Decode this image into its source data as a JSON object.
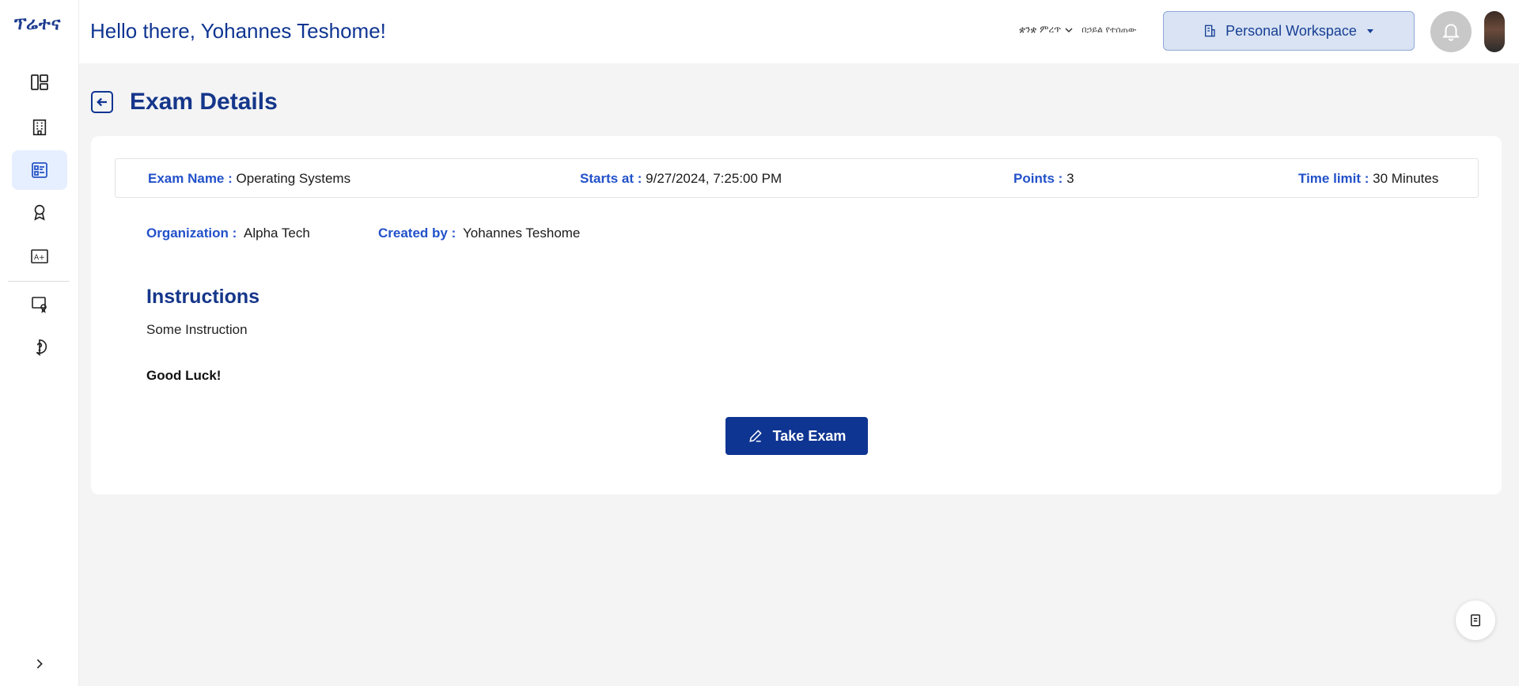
{
  "app": {
    "logo_text": "ፕሬተና",
    "greeting": "Hello there, Yohannes Teshome!",
    "language_label": "ቋንቋ ምረጥ",
    "language_sub": "በኃይል የተሰጠው",
    "workspace_label": "Personal Workspace"
  },
  "sidebar": {
    "items": [
      {
        "icon": "dashboard-icon"
      },
      {
        "icon": "building-icon"
      },
      {
        "icon": "exam-list-icon",
        "active": true
      },
      {
        "icon": "award-icon"
      },
      {
        "icon": "grades-icon"
      },
      {
        "icon": "certificate-icon"
      },
      {
        "icon": "help-icon"
      }
    ],
    "expand_icon": "chevron-right-icon"
  },
  "page": {
    "title": "Exam Details"
  },
  "exam": {
    "name_label": "Exam Name :",
    "name": "Operating Systems",
    "starts_label": "Starts at :",
    "starts": "9/27/2024, 7:25:00 PM",
    "points_label": "Points :",
    "points": "3",
    "time_label": "Time limit :",
    "time": "30 Minutes",
    "org_label": "Organization :",
    "org": "Alpha Tech",
    "created_label": "Created by :",
    "created": "Yohannes Teshome"
  },
  "instructions": {
    "heading": "Instructions",
    "text": "Some Instruction",
    "closing": "Good Luck!"
  },
  "actions": {
    "take_exam": "Take Exam"
  },
  "colors": {
    "primary": "#0f3592",
    "label_blue": "#2251c9",
    "active_bg": "#e6efff",
    "workspace_bg": "#d9e3f3"
  }
}
